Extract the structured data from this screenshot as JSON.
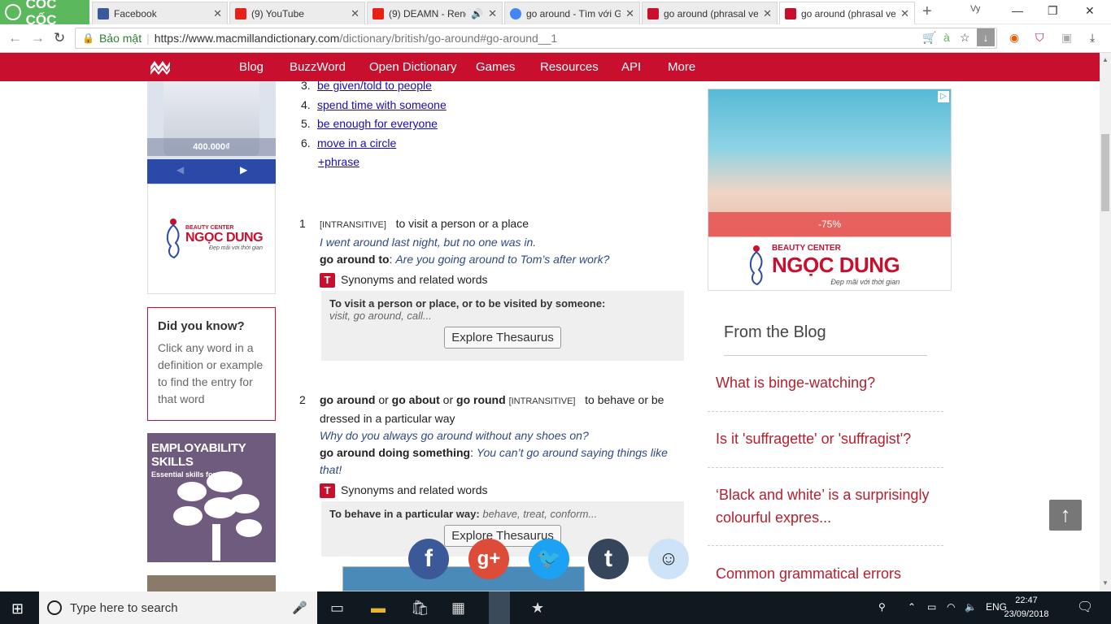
{
  "browser": {
    "brand": "CỐC CỐC",
    "tabs": [
      {
        "title": "Facebook",
        "color": "#3b5998"
      },
      {
        "title": "(9) YouTube",
        "color": "#e62117"
      },
      {
        "title": "(9) DEAMN - Rend",
        "color": "#e62117"
      },
      {
        "title": "go around - Tìm với G",
        "color": "#4285f4"
      },
      {
        "title": "go around (phrasal ve",
        "color": "#c8102e"
      },
      {
        "title": "go around (phrasal ve",
        "color": "#c8102e"
      }
    ],
    "secure_label": "Bảo mật",
    "url_host": "https://www.macmillandictionary.com",
    "url_path": "/dictionary/british/go-around#go-around__1"
  },
  "site": {
    "nav": [
      "Blog",
      "BuzzWord",
      "Open Dictionary",
      "Games",
      "Resources",
      "API",
      "More"
    ],
    "accent": "#c8102e"
  },
  "left": {
    "price": "400.000₫",
    "ngoc_small": "BEAUTY CENTER",
    "ngoc_big": "NGỌC DUNG",
    "ngoc_slogan": "Đẹp mãi với thời gian",
    "didyou_title": "Did you know?",
    "didyou_text": "Click any word in a definition or example to find the entry for that word",
    "employ_title": "EMPLOYABILITY SKILLS",
    "employ_sub": "Essential skills for work"
  },
  "senses": [
    {
      "n": "3.",
      "text": "be given/told to people"
    },
    {
      "n": "4.",
      "text": "spend time with someone"
    },
    {
      "n": "5.",
      "text": "be enough for everyone"
    },
    {
      "n": "6.",
      "text": "move in a circle"
    }
  ],
  "phrase_link": "+phrase",
  "entry1": {
    "num": "1",
    "gram": "[INTRANSITIVE]",
    "def": "to visit a person or a place",
    "ex1": "I went around last night, but no one was in.",
    "pattern": "go around to",
    "ex2": "Are you going around to Tom’s after work?",
    "syn": "Synonyms and related words",
    "thes_lead": "To visit a person or place, or to be visited by someone:",
    "thes_list": "visit, go around, call...",
    "thes_btn": "Explore Thesaurus"
  },
  "entry2": {
    "num": "2",
    "p1": "go around",
    "or1": "or",
    "p2": "go about",
    "or2": "or",
    "p3": "go round",
    "gram": "[INTRANSITIVE]",
    "def": "to behave or be dressed in a particular way",
    "ex1": "Why do you always go around without any shoes on?",
    "pattern": "go around doing something",
    "ex2": "You can’t go around saying things like that!",
    "syn": "Synonyms and related words",
    "thes_lead": "To behave in a particular way:",
    "thes_list": "behave, treat, conform...",
    "thes_btn": "Explore Thesaurus"
  },
  "right": {
    "discount": "-75%",
    "ngoc_small": "BEAUTY CENTER",
    "ngoc_big": "NGỌC DUNG",
    "ngoc_slogan": "Đẹp mãi với thời gian",
    "blog_title": "From the Blog",
    "posts": [
      "What is binge-watching?",
      "Is it 'suffragette' or 'suffragist'?",
      "‘Black and white’ is a surprisingly colourful expres...",
      "Common grammatical errors"
    ]
  },
  "taskbar": {
    "search_placeholder": "Type here to search",
    "lang": "ENG",
    "time": "22:47",
    "date": "23/09/2018"
  }
}
